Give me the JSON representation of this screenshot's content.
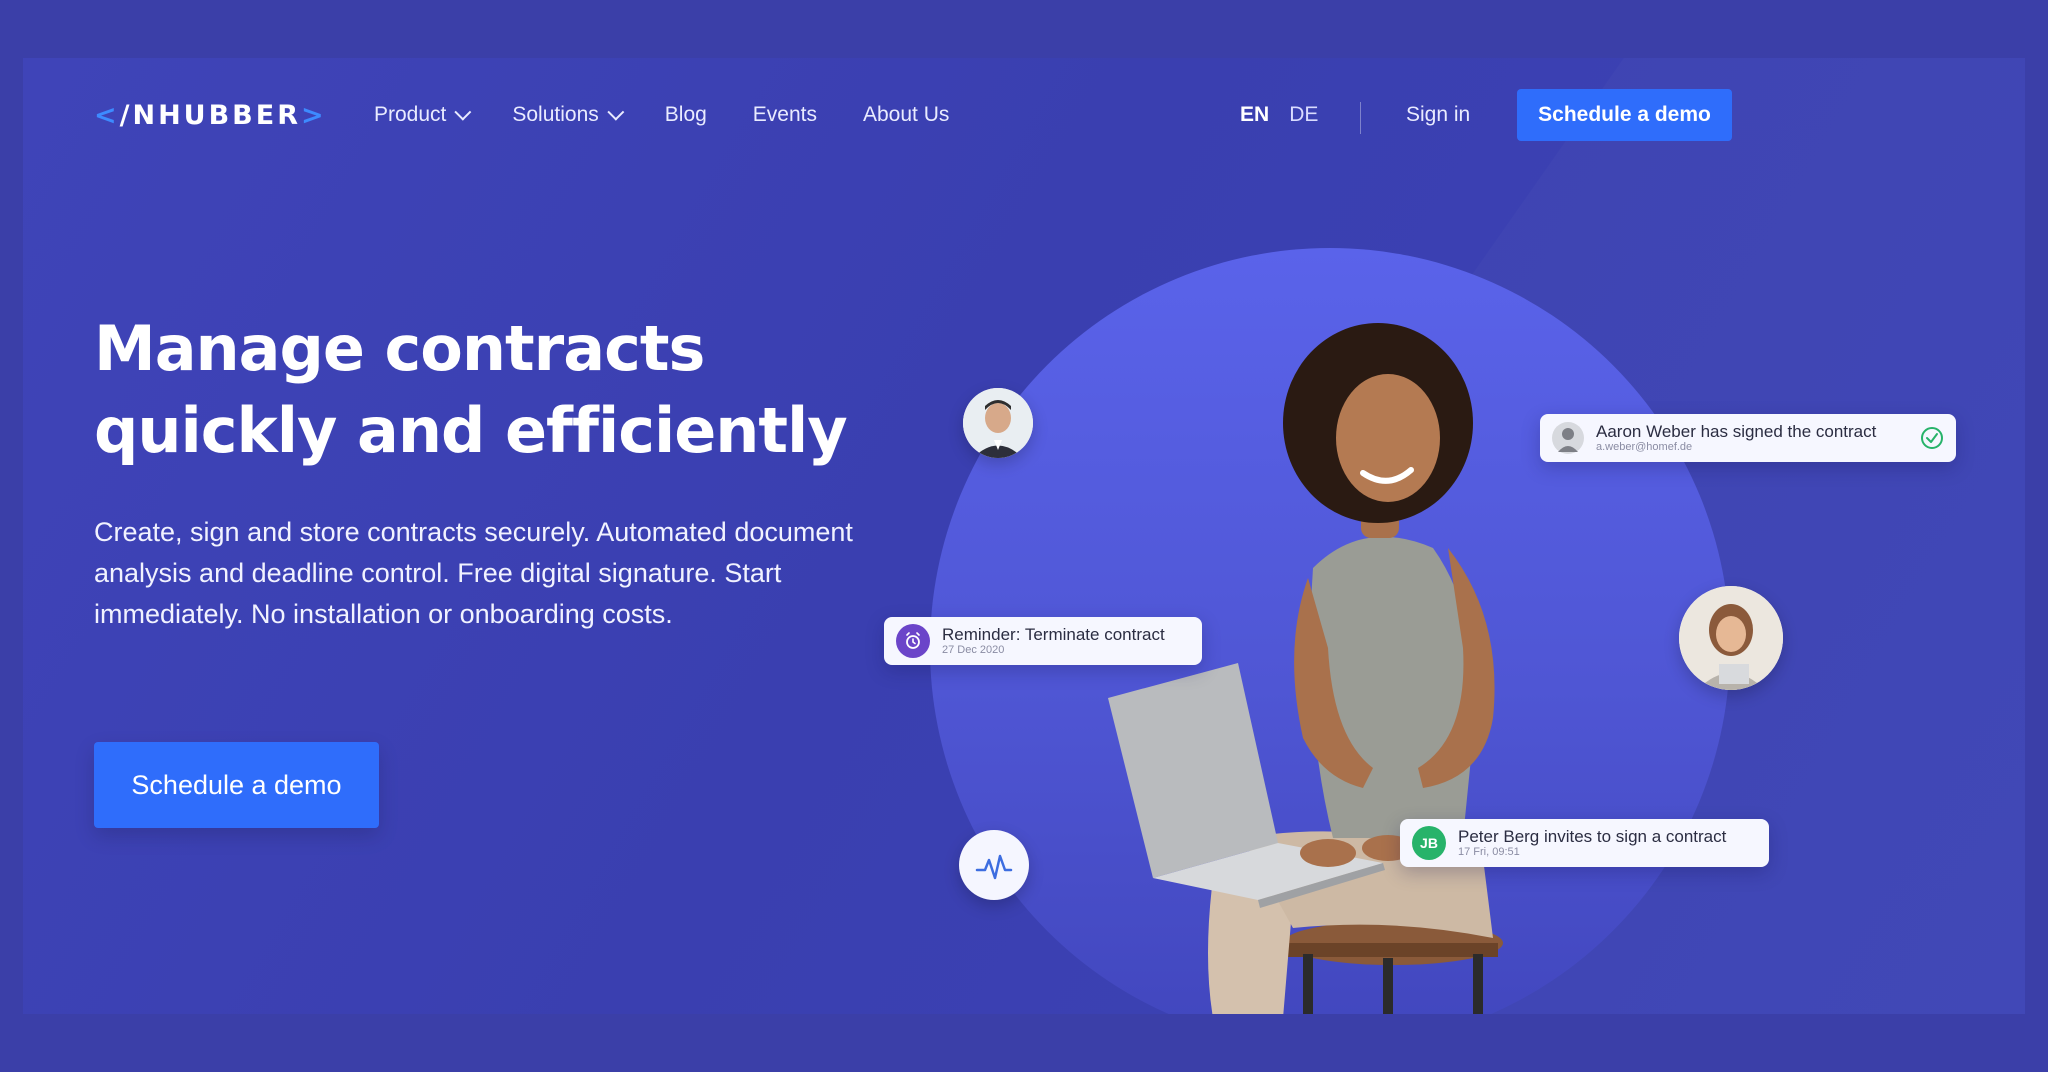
{
  "header": {
    "logo": {
      "left": "<",
      "text": "/NHUBBER",
      "right": ">"
    },
    "nav": [
      {
        "label": "Product",
        "dropdown": true
      },
      {
        "label": "Solutions",
        "dropdown": true
      },
      {
        "label": "Blog",
        "dropdown": false
      },
      {
        "label": "Events",
        "dropdown": false
      },
      {
        "label": "About Us",
        "dropdown": false
      }
    ],
    "languages": {
      "active": "EN",
      "other": "DE"
    },
    "signin": "Sign in",
    "cta": "Schedule a demo"
  },
  "hero": {
    "title_line1": "Manage contracts",
    "title_line2": "quickly and efficiently",
    "subtitle": "Create, sign and store contracts securely. Automated document analysis and deadline control. Free digital signature. Start immediately. No installation or onboarding costs.",
    "cta": "Schedule a demo"
  },
  "cards": {
    "signed": {
      "title": "Aaron Weber has signed the contract",
      "meta": "a.weber@homef.de"
    },
    "reminder": {
      "title": "Reminder: Terminate contract",
      "meta": "27 Dec 2020"
    },
    "invite": {
      "initials": "JB",
      "title": "Peter Berg invites to sign a contract",
      "meta": "17 Fri, 09:51"
    }
  },
  "colors": {
    "background": "#3b3fa8",
    "accent": "#2f6dfb",
    "circle": "#5a63ea",
    "success": "#27b36a",
    "reminder": "#6b45c9"
  }
}
